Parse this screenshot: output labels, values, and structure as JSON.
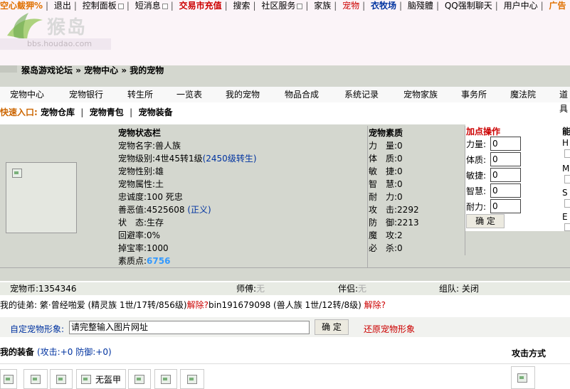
{
  "topnav": {
    "items": [
      "空心鲅狎%",
      "退出",
      "控制面板",
      "短消息",
      "交易市充值",
      "搜索",
      "社区服务",
      "家族",
      "宠物",
      "衣牧场",
      "脑殘體",
      "QQ强制聊天",
      "用户中心",
      "广告"
    ]
  },
  "logo": {
    "text": "猴岛",
    "url": "bbs.houdao.com"
  },
  "breadcrumb": {
    "items": [
      "猴岛游戏论坛",
      "宠物中心",
      "我的宠物"
    ]
  },
  "menu": [
    "宠物中心",
    "宠物银行",
    "转生所",
    "一览表",
    "我的宠物",
    "物品合成",
    "系统记录",
    "宠物家族",
    "事务所",
    "魔法院",
    "道具"
  ],
  "quick": {
    "label": "快速入口:",
    "links": [
      "宠物仓库",
      "宠物青包",
      "宠物装备"
    ]
  },
  "status": {
    "title": "宠物状态栏",
    "name_label": "宠物名字:",
    "name": "兽人族",
    "level_label": "宠物级别:",
    "level": "4世45转1级",
    "level_link": "(2450级转生)",
    "gender_label": "宠物性别:",
    "gender": "雄",
    "attr_label": "宠物属性:",
    "attr": "土",
    "loyalty_label": "忠诚度:",
    "loyalty": "100 死忠",
    "karma_label": "善恶值:",
    "karma": "4525608",
    "karma_link": "(正义)",
    "state_label": "状　态:",
    "state": "生存",
    "dodge_label": "回避率:",
    "dodge": "0%",
    "drop_label": "掉宝率:",
    "drop": "1000",
    "points_label": "素质点:",
    "points": "6756"
  },
  "quality": {
    "title": "宠物素质",
    "rows": [
      {
        "label": "力　量:",
        "value": "0"
      },
      {
        "label": "体　质:",
        "value": "0"
      },
      {
        "label": "敏　捷:",
        "value": "0"
      },
      {
        "label": "智　慧:",
        "value": "0"
      },
      {
        "label": "耐　力:",
        "value": "0"
      },
      {
        "label": "攻　击:",
        "value": "2292"
      },
      {
        "label": "防　御:",
        "value": "2213"
      },
      {
        "label": "魔　攻:",
        "value": "2"
      },
      {
        "label": "必　杀:",
        "value": "0"
      }
    ]
  },
  "addpoints": {
    "title": "加点操作",
    "fields": [
      {
        "label": "力量:",
        "value": "0"
      },
      {
        "label": "体质:",
        "value": "0"
      },
      {
        "label": "敏捷:",
        "value": "0"
      },
      {
        "label": "智慧:",
        "value": "0"
      },
      {
        "label": "耐力:",
        "value": "0"
      }
    ],
    "confirm": "确 定"
  },
  "rightcol": {
    "title": "能",
    "letters": [
      "H",
      "M",
      "S",
      "E"
    ]
  },
  "money": {
    "label": "宠物币:",
    "value": "1354346",
    "master_label": "师傅:",
    "master": "无",
    "partner_label": "伴侣:",
    "partner": "无",
    "org_label": "组队:",
    "org": "关闭"
  },
  "apprentice": {
    "label": "我的徒弟:",
    "a1": "綮·曾经啪爱 (精灵族 1世/17转/856级)",
    "a1_link": "解除?",
    "a2": "bin191679098 (兽人族 1世/12转/8级)",
    "a2_link": "解除?"
  },
  "custom": {
    "label": "自定宠物形象:",
    "placeholder": "请完整输入图片网址",
    "confirm": "确 定",
    "restore": "还原宠物形象"
  },
  "equipment": {
    "title": "我的装备",
    "stats": "(攻击:+0 防御:+0)",
    "attack_mode": "攻击方式",
    "armor": "无盔甲"
  },
  "colors": {
    "accent_red": "#cc0000",
    "accent_blue": "#0033a0",
    "panel": "#d4d7cf"
  }
}
